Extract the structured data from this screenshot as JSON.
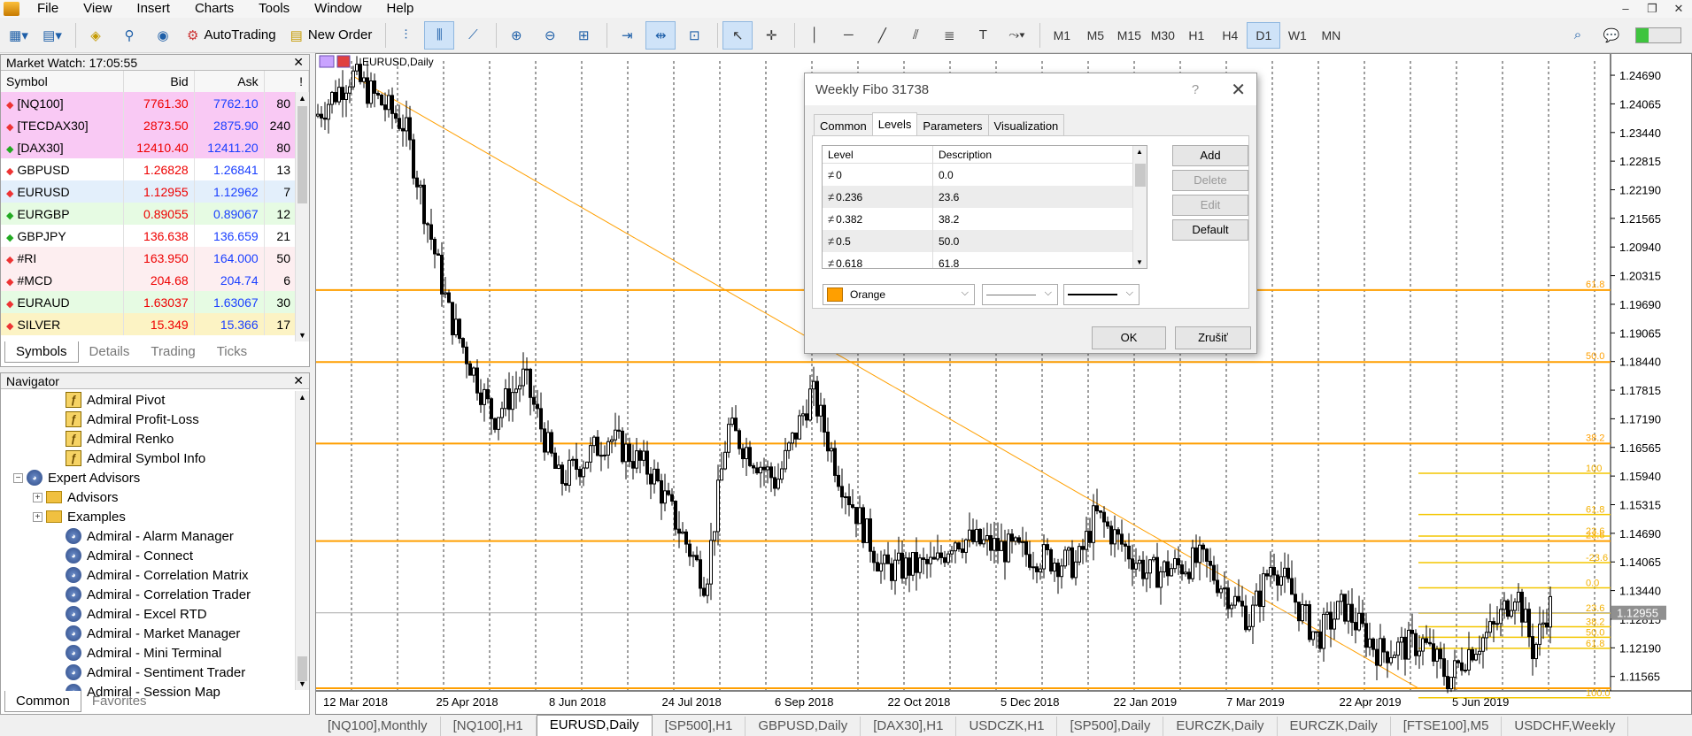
{
  "menu": [
    "File",
    "View",
    "Insert",
    "Charts",
    "Tools",
    "Window",
    "Help"
  ],
  "toolbar": {
    "autotrading": "AutoTrading",
    "new_order": "New Order",
    "timeframes": [
      "M1",
      "M5",
      "M15",
      "M30",
      "H1",
      "H4",
      "D1",
      "W1",
      "MN"
    ],
    "active_timeframe": "D1"
  },
  "market_watch": {
    "title": "Market Watch: 17:05:55",
    "columns": [
      "Symbol",
      "Bid",
      "Ask",
      "!"
    ],
    "rows": [
      {
        "symbol": "[NQ100]",
        "bid": "7761.30",
        "ask": "7762.10",
        "spread": "80",
        "dir": "down",
        "bg": "#f9c9f4"
      },
      {
        "symbol": "[TECDAX30]",
        "bid": "2873.50",
        "ask": "2875.90",
        "spread": "240",
        "dir": "down",
        "bg": "#f9c9f4"
      },
      {
        "symbol": "[DAX30]",
        "bid": "12410.40",
        "ask": "12411.20",
        "spread": "80",
        "dir": "up",
        "bg": "#f9c9f4"
      },
      {
        "symbol": "GBPUSD",
        "bid": "1.26828",
        "ask": "1.26841",
        "spread": "13",
        "dir": "down",
        "bg": "#ffffff"
      },
      {
        "symbol": "EURUSD",
        "bid": "1.12955",
        "ask": "1.12962",
        "spread": "7",
        "dir": "down",
        "bg": "#e3effb"
      },
      {
        "symbol": "EURGBP",
        "bid": "0.89055",
        "ask": "0.89067",
        "spread": "12",
        "dir": "up",
        "bg": "#e6fbe3"
      },
      {
        "symbol": "GBPJPY",
        "bid": "136.638",
        "ask": "136.659",
        "spread": "21",
        "dir": "up",
        "bg": "#ffffff"
      },
      {
        "symbol": "#RI",
        "bid": "163.950",
        "ask": "164.000",
        "spread": "50",
        "dir": "down",
        "bg": "#fdeef0"
      },
      {
        "symbol": "#MCD",
        "bid": "204.68",
        "ask": "204.74",
        "spread": "6",
        "dir": "down",
        "bg": "#fdeef0"
      },
      {
        "symbol": "EURAUD",
        "bid": "1.63037",
        "ask": "1.63067",
        "spread": "30",
        "dir": "down",
        "bg": "#e6fbe3"
      },
      {
        "symbol": "SILVER",
        "bid": "15.349",
        "ask": "15.366",
        "spread": "17",
        "dir": "down",
        "bg": "#fcf3c4"
      }
    ],
    "tabs": [
      "Symbols",
      "Details",
      "Trading",
      "Ticks"
    ],
    "active_tab": "Symbols"
  },
  "navigator": {
    "title": "Navigator",
    "items": [
      {
        "label": "Admiral Pivot",
        "type": "ind",
        "indent": 2
      },
      {
        "label": "Admiral Profit-Loss",
        "type": "ind",
        "indent": 2
      },
      {
        "label": "Admiral Renko",
        "type": "ind",
        "indent": 2
      },
      {
        "label": "Admiral Symbol Info",
        "type": "ind",
        "indent": 2
      },
      {
        "label": "Expert Advisors",
        "type": "ea",
        "indent": 0,
        "expander": "−"
      },
      {
        "label": "Advisors",
        "type": "folder",
        "indent": 1,
        "expander": "+"
      },
      {
        "label": "Examples",
        "type": "folder",
        "indent": 1,
        "expander": "+"
      },
      {
        "label": "Admiral - Alarm Manager",
        "type": "ea",
        "indent": 2
      },
      {
        "label": "Admiral - Connect",
        "type": "ea",
        "indent": 2
      },
      {
        "label": "Admiral - Correlation Matrix",
        "type": "ea",
        "indent": 2
      },
      {
        "label": "Admiral - Correlation Trader",
        "type": "ea",
        "indent": 2
      },
      {
        "label": "Admiral - Excel RTD",
        "type": "ea",
        "indent": 2
      },
      {
        "label": "Admiral - Market Manager",
        "type": "ea",
        "indent": 2
      },
      {
        "label": "Admiral - Mini Terminal",
        "type": "ea",
        "indent": 2
      },
      {
        "label": "Admiral - Sentiment Trader",
        "type": "ea",
        "indent": 2
      },
      {
        "label": "Admiral - Session Map",
        "type": "ea",
        "indent": 2
      }
    ],
    "tabs": [
      "Common",
      "Favorites"
    ],
    "active_tab": "Common"
  },
  "chart": {
    "label": "EURUSD,Daily",
    "current_price": "1.12955",
    "price_ticks": [
      "1.24690",
      "1.24065",
      "1.23440",
      "1.22815",
      "1.22190",
      "1.21565",
      "1.20940",
      "1.20315",
      "1.19690",
      "1.19065",
      "1.18440",
      "1.17815",
      "1.17190",
      "1.16565",
      "1.15940",
      "1.15315",
      "1.14690",
      "1.14065",
      "1.13440",
      "1.12815",
      "1.12190",
      "1.11565"
    ],
    "date_ticks": [
      "12 Mar 2018",
      "25 Apr 2018",
      "8 Jun 2018",
      "24 Jul 2018",
      "6 Sep 2018",
      "22 Oct 2018",
      "5 Dec 2018",
      "22 Jan 2019",
      "7 Mar 2019",
      "22 Apr 2019",
      "5 Jun 2019"
    ],
    "fibo_main": [
      {
        "label": "61.8",
        "price": 1.2
      },
      {
        "label": "50.0",
        "price": 1.1843
      },
      {
        "label": "38.2",
        "price": 1.1665
      },
      {
        "label": "23.6",
        "price": 1.1452
      }
    ],
    "fibo_weekly": [
      {
        "label": "100",
        "price": 1.16
      },
      {
        "label": "61.8",
        "price": 1.151
      },
      {
        "label": "23.6",
        "price": 1.1463
      },
      {
        "label": "-23.6",
        "price": 1.1405
      },
      {
        "label": "0.0",
        "price": 1.135
      },
      {
        "label": "23.6",
        "price": 1.1295
      },
      {
        "label": "38.2",
        "price": 1.1265
      },
      {
        "label": "50.0",
        "price": 1.1242
      },
      {
        "label": "61.8",
        "price": 1.1218
      },
      {
        "label": "100.0",
        "price": 1.111
      }
    ]
  },
  "chart_tabs": [
    "[NQ100],Monthly",
    "[NQ100],H1",
    "EURUSD,Daily",
    "[SP500],H1",
    "GBPUSD,Daily",
    "[DAX30],H1",
    "USDCZK,H1",
    "[SP500],Daily",
    "EURCZK,Daily",
    "EURCZK,Daily",
    "[FTSE100],M5",
    "USDCHF,Weekly"
  ],
  "active_chart_tab": "EURUSD,Daily",
  "dialog": {
    "title": "Weekly Fibo 31738",
    "help": "?",
    "close": "✕",
    "tabs": [
      "Common",
      "Levels",
      "Parameters",
      "Visualization"
    ],
    "active_tab": "Levels",
    "grid_headers": [
      "Level",
      "Description"
    ],
    "levels": [
      {
        "level": "0",
        "desc": "0.0"
      },
      {
        "level": "0.236",
        "desc": "23.6"
      },
      {
        "level": "0.382",
        "desc": "38.2"
      },
      {
        "level": "0.5",
        "desc": "50.0"
      },
      {
        "level": "0.618",
        "desc": "61.8"
      }
    ],
    "buttons": {
      "add": "Add",
      "delete": "Delete",
      "edit": "Edit",
      "default": "Default"
    },
    "color_name": "Orange",
    "color": "#ff9f00",
    "ok": "OK",
    "cancel": "Zrušiť"
  }
}
